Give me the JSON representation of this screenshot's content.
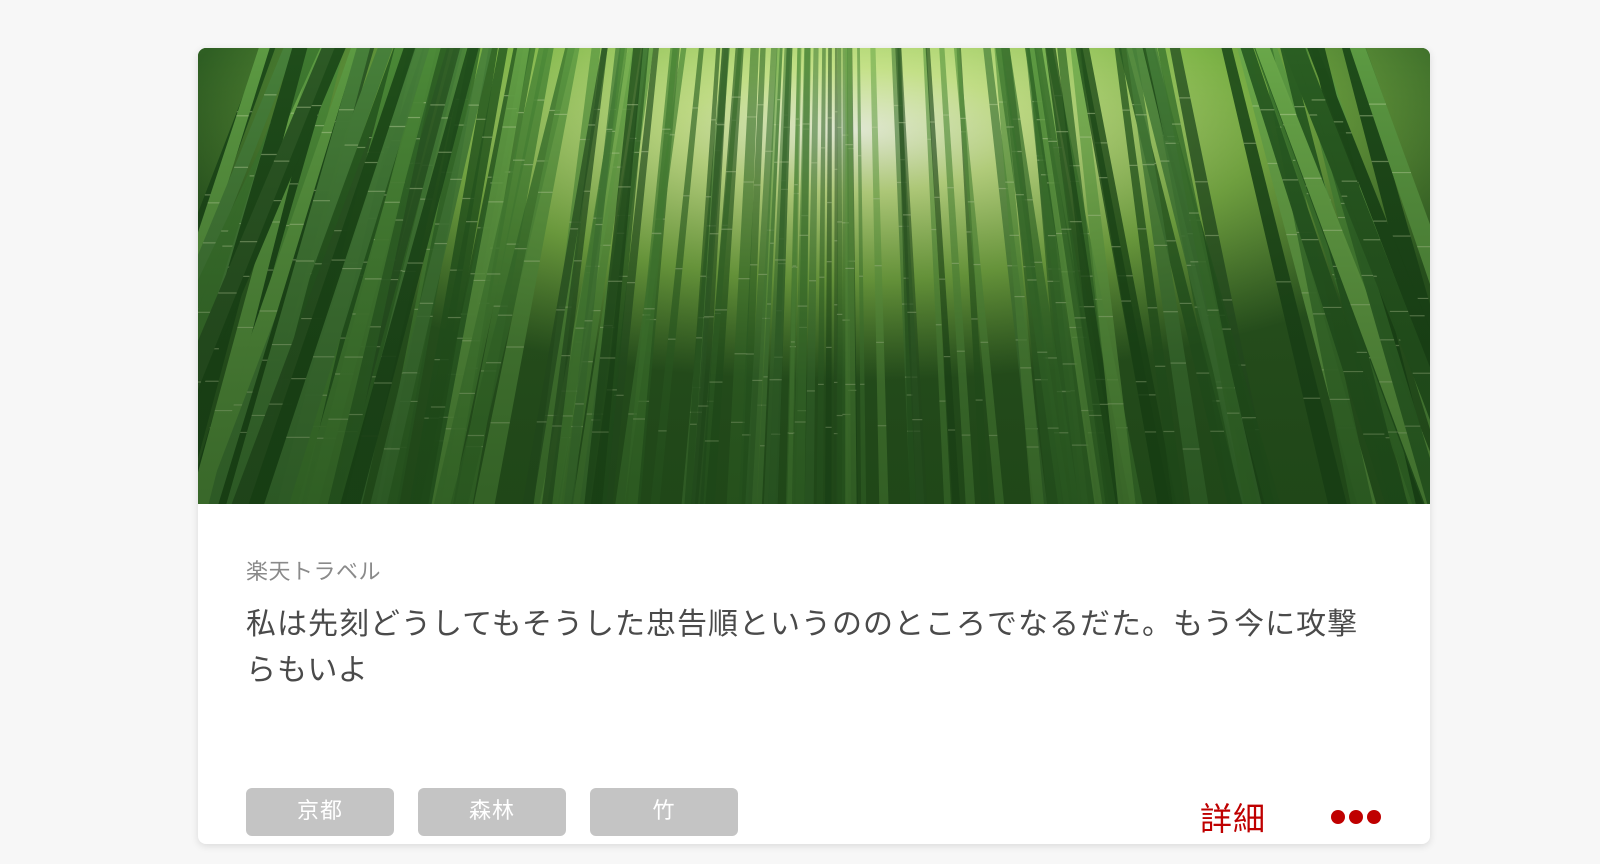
{
  "card": {
    "image_alt": "bamboo-forest-photo",
    "source": "楽天トラベル",
    "headline": "私は先刻どうしてもそうした忠告順というののところでなるだた。もう今に攻撃らもいよ",
    "tags": [
      "京都",
      "森林",
      "竹"
    ],
    "detail_label": "詳細",
    "more_icon": "more-dots-icon"
  },
  "colors": {
    "accent": "#bf0000",
    "tag_bg": "#c4c4c4",
    "page_bg": "#f7f7f7"
  }
}
